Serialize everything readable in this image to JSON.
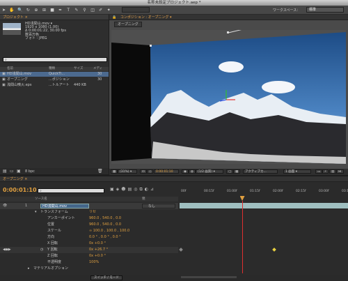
{
  "app": {
    "window_title": "名称未設定プロジェクト.aep *",
    "workspace_label": "ワークスペース：",
    "workspace_value": "標準"
  },
  "project_panel": {
    "tab": "プロジェクト ×",
    "selected": {
      "name": "HD浅間山.mov ▾",
      "size": "1920 x 1080 (1.00)",
      "duration": "Δ 0:00:01:22, 30.00 fps",
      "colors": "数百万色",
      "codec": "フォト - JPEG"
    },
    "columns": {
      "name": "名前",
      "type": "種類",
      "size": "サイズ",
      "rate": "メディ"
    },
    "items": [
      {
        "name": "HD浅間山.mov",
        "type": "QuickTi...",
        "size": "",
        "rate": "30",
        "selected": true
      },
      {
        "name": "オープニング",
        "type": "...ポジション",
        "size": "",
        "rate": "30",
        "selected": false
      },
      {
        "name": "浅間山噴火.eps",
        "type": "...トルアート",
        "size": "440 KB",
        "rate": "",
        "selected": false
      }
    ],
    "bpc": "8 bpc"
  },
  "composition_panel": {
    "tab": "コンポジション : オープニング ▾",
    "comp_button": "オープニング",
    "zoom": "(31%) ▾",
    "timecode": "0:00:01:10",
    "resolution": "(1/2 画質) ▾",
    "camera": "アクティブカ...",
    "views": "1 画面 ▾"
  },
  "timeline_panel": {
    "tab": "オープニング ×",
    "current_time": "0:00:01:10",
    "source_name_header": "ソース名",
    "parent_header": "親",
    "parent_value": "なし",
    "layer": {
      "index": "1",
      "name": "HD浅間山.mov"
    },
    "transform": {
      "label": "トランスフォーム",
      "reset": "リセ"
    },
    "properties": [
      {
        "label": "アンカーポイント",
        "value": "960.0 , 540.0 , 0.0"
      },
      {
        "label": "位置",
        "value": "960.0 , 540.0 , 0.0"
      },
      {
        "label": "スケール",
        "value": "∞ 100.0 , 100.0 , 100.0"
      },
      {
        "label": "方向",
        "value": "0.0 ° , 0.0 ° , 0.0 °"
      },
      {
        "label": "X 回転",
        "value": "0x +0.0 °"
      },
      {
        "label": "Y 回転",
        "value": "0x +26.7 °",
        "keyframed": true
      },
      {
        "label": "Z 回転",
        "value": "0x +0.0 °"
      },
      {
        "label": "不透明度",
        "value": "100%"
      }
    ],
    "material_options": "マテリアルオプション",
    "toggle_label": "スイッチ / モード",
    "ruler_ticks": [
      "00f",
      "00:15f",
      "01:00f",
      "01:15f",
      "02:00f",
      "02:15f",
      "03:00f",
      "03:15f"
    ],
    "playhead_fraction": 0.37,
    "keyframe_fraction": 0.56
  }
}
